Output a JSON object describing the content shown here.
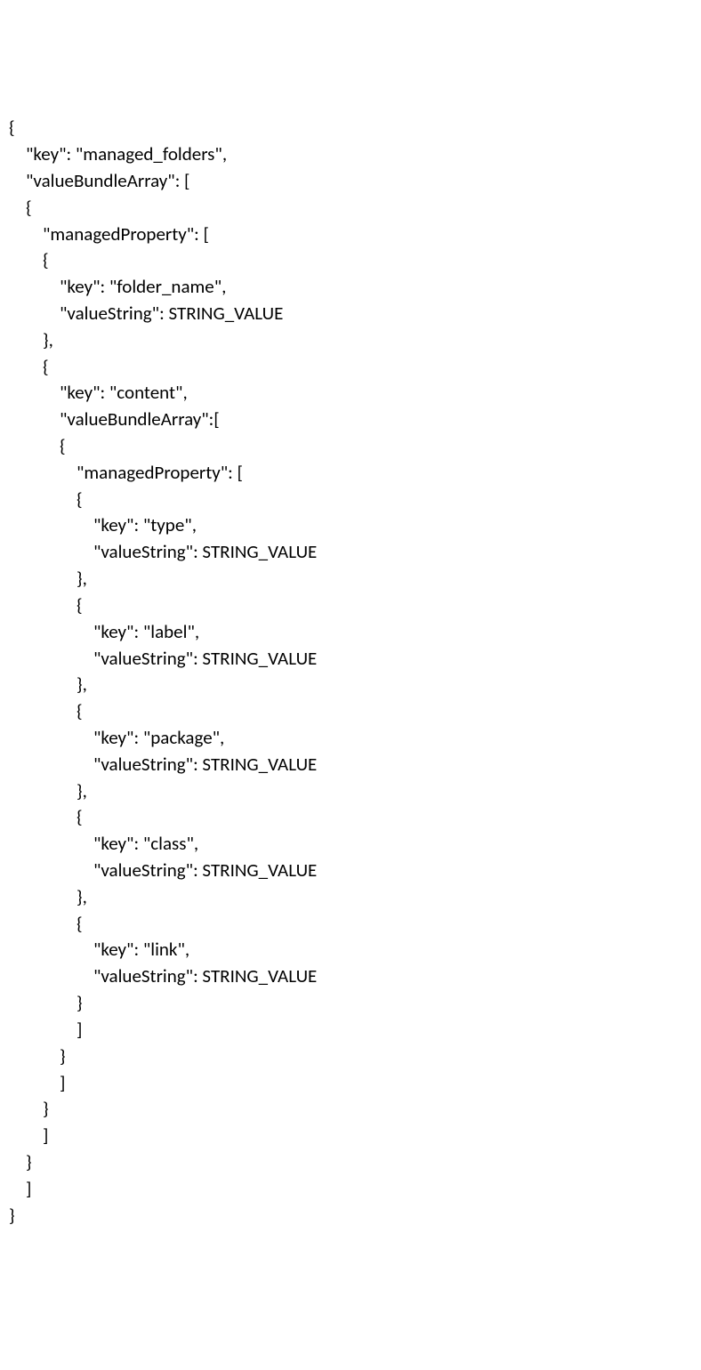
{
  "code": {
    "l1": "{",
    "l2": "    \"key\": \"managed_folders\",",
    "l3": "    \"valueBundleArray\": [",
    "l4": "    {",
    "l5": "        \"managedProperty\": [",
    "l6": "        {",
    "l7": "            \"key\": \"folder_name\",",
    "l8": "            \"valueString\": STRING_VALUE",
    "l9": "        },",
    "l10": "        {",
    "l11": "            \"key\": \"content\",",
    "l12": "            \"valueBundleArray\":[",
    "l13": "            {",
    "l14": "                \"managedProperty\": [",
    "l15": "                {",
    "l16": "                    \"key\": \"type\",",
    "l17": "                    \"valueString\": STRING_VALUE",
    "l18": "                },",
    "l19": "                {",
    "l20": "                    \"key\": \"label\",",
    "l21": "                    \"valueString\": STRING_VALUE",
    "l22": "                },",
    "l23": "                {",
    "l24": "                    \"key\": \"package\",",
    "l25": "                    \"valueString\": STRING_VALUE",
    "l26": "                },",
    "l27": "                {",
    "l28": "                    \"key\": \"class\",",
    "l29": "                    \"valueString\": STRING_VALUE",
    "l30": "                },",
    "l31": "                {",
    "l32": "                    \"key\": \"link\",",
    "l33": "                    \"valueString\": STRING_VALUE",
    "l34": "                }",
    "l35": "                ]",
    "l36": "            }",
    "l37": "            ]",
    "l38": "        }",
    "l39": "        ]",
    "l40": "    }",
    "l41": "    ]",
    "l42": "}"
  }
}
